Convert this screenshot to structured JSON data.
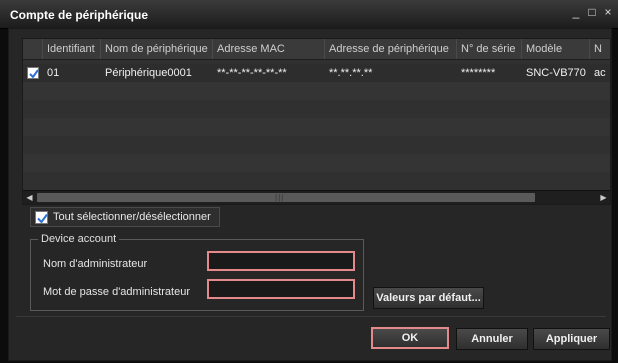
{
  "window": {
    "title": "Compte de périphérique",
    "controls": {
      "minimize": "_",
      "maximize": "□",
      "close": "×"
    }
  },
  "table": {
    "columns": [
      "",
      "Identifiant",
      "Nom de périphérique",
      "Adresse MAC",
      "Adresse de périphérique",
      "N° de série",
      "Modèle",
      "N"
    ],
    "rows": [
      {
        "checked": true,
        "cells": [
          "01",
          "Périphérique0001",
          "**-**-**-**-**-**",
          "**.**.**.**",
          "********",
          "SNC-VB770",
          "ac"
        ]
      }
    ],
    "empty_rows": 7,
    "scroll_grip": "|||"
  },
  "select_all": {
    "label": "Tout sélectionner/désélectionner",
    "checked": true
  },
  "device_account": {
    "legend": "Device account",
    "admin_name_label": "Nom d'administrateur",
    "admin_name_value": "",
    "admin_password_label": "Mot de passe d'administrateur",
    "admin_password_value": ""
  },
  "buttons": {
    "defaults": "Valeurs par défaut...",
    "ok": "OK",
    "cancel": "Annuler",
    "apply": "Appliquer"
  },
  "colors": {
    "highlight": "#e48a8a",
    "check": "#2a6fd6"
  }
}
